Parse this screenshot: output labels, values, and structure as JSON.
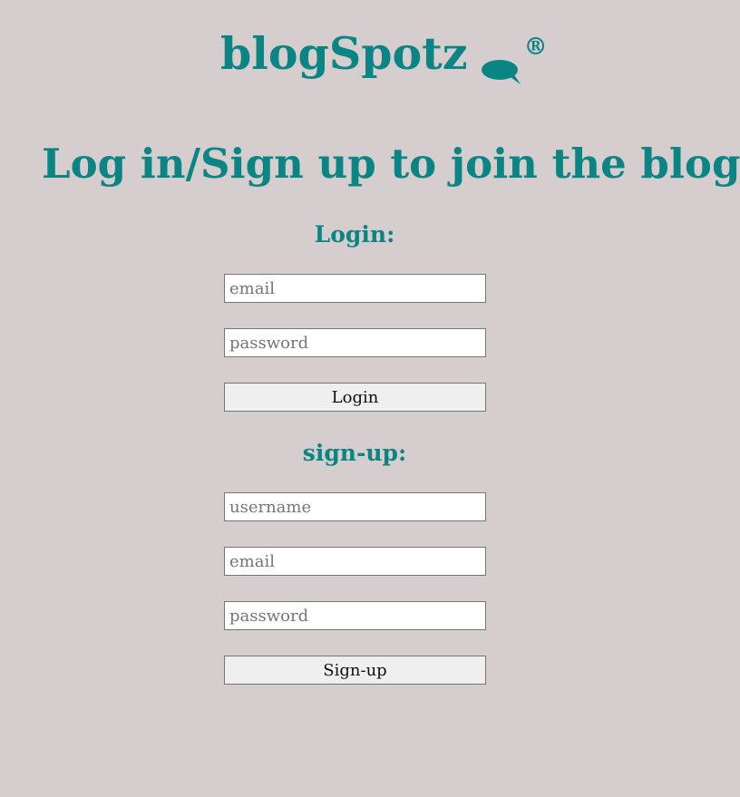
{
  "brand": {
    "name": "blogSpotz",
    "icon": "speech-bubble-icon",
    "registered_mark": "®",
    "accent_color": "#0b8584"
  },
  "headline": "Log in/Sign up to join the blog!!",
  "login": {
    "title": "Login:",
    "email_placeholder": "email",
    "password_placeholder": "password",
    "button_label": "Login"
  },
  "signup": {
    "title": "sign-up:",
    "username_placeholder": "username",
    "email_placeholder": "email",
    "password_placeholder": "password",
    "button_label": "Sign-up"
  },
  "colors": {
    "background": "#d6cdce",
    "accent": "#0b8584",
    "button_bg": "#efefef"
  }
}
